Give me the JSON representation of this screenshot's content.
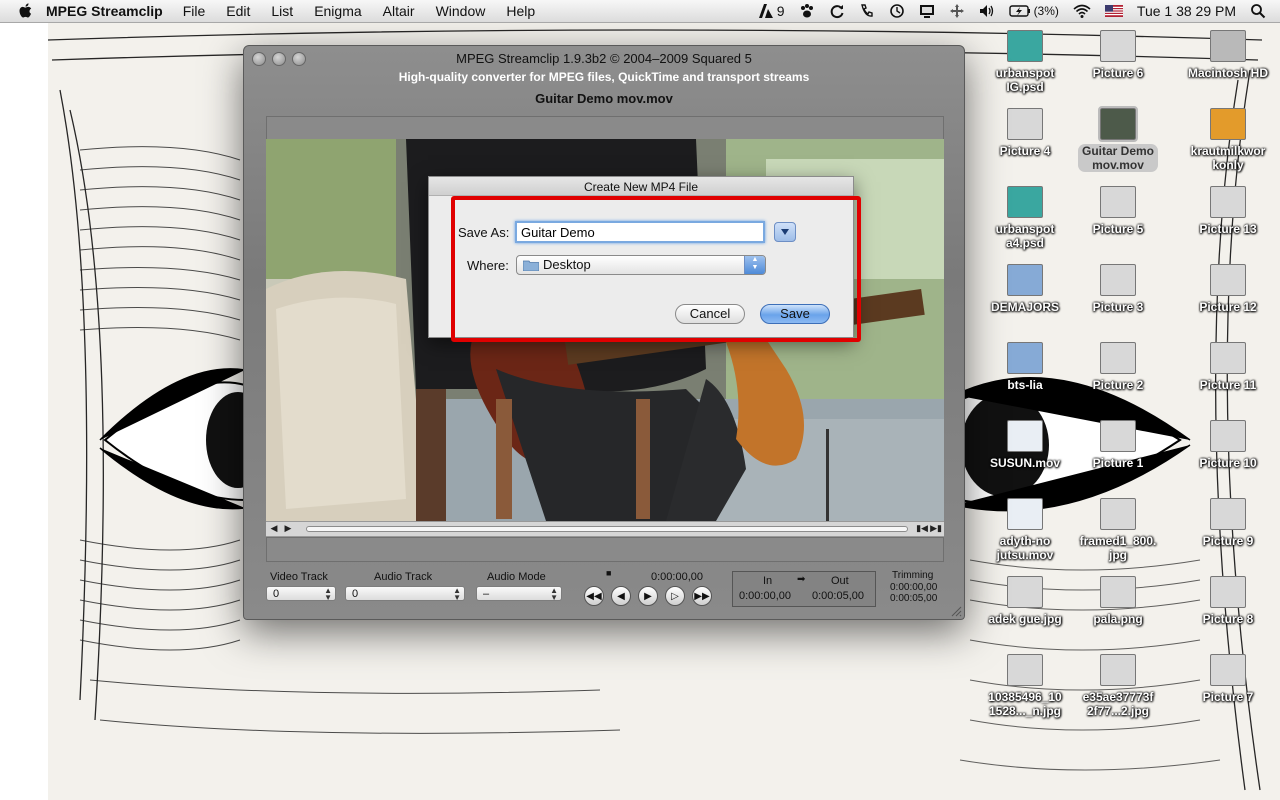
{
  "menubar": {
    "app_name": "MPEG Streamclip",
    "menus": [
      "File",
      "Edit",
      "List",
      "Enigma",
      "Altair",
      "Window",
      "Help"
    ],
    "status": {
      "adobe_count": "9",
      "battery": "(3%)",
      "clock": "Tue 1 38 29 PM"
    }
  },
  "window": {
    "title": "MPEG Streamclip 1.9.3b2  ©  2004–2009 Squared 5",
    "subtitle": "High-quality converter for MPEG files, QuickTime and transport streams",
    "file_name": "Guitar Demo mov.mov",
    "controls": {
      "video_track_label": "Video Track",
      "video_track_value": "0",
      "audio_track_label": "Audio Track",
      "audio_track_value": "0",
      "audio_mode_label": "Audio Mode",
      "audio_mode_value": "–",
      "timecode": "0:00:00,00",
      "in_label": "In",
      "out_label": "Out",
      "in_value": "0:00:00,00",
      "out_value": "0:00:05,00",
      "trimming_label": "Trimming",
      "trimming_in": "0:00:00,00",
      "trimming_out": "0:00:05,00"
    }
  },
  "dialog": {
    "title": "Create New MP4 File",
    "save_as_label": "Save As:",
    "save_as_value": "Guitar Demo",
    "where_label": "Where:",
    "where_value": "Desktop",
    "cancel_label": "Cancel",
    "save_label": "Save"
  },
  "desktop_icons": [
    {
      "label": "urbanspot\nIG.psd",
      "kind": "psd-icon"
    },
    {
      "label": "Picture 6",
      "kind": "image-icon"
    },
    {
      "label": "Macintosh HD",
      "kind": "hard-drive-icon"
    },
    {
      "label": "Picture 4",
      "kind": "image-icon"
    },
    {
      "label": "Guitar Demo\nmov.mov",
      "kind": "movie-icon"
    },
    {
      "label": "krautmilkwor\nkonly",
      "kind": "usb-drive-icon"
    },
    {
      "label": "urbanspot\na4.psd",
      "kind": "psd-icon"
    },
    {
      "label": "Picture 5",
      "kind": "image-icon"
    },
    {
      "label": "Picture 13",
      "kind": "image-icon"
    },
    {
      "label": "DEMAJORS",
      "kind": "folder-icon"
    },
    {
      "label": "Picture 3",
      "kind": "image-icon"
    },
    {
      "label": "Picture 12",
      "kind": "image-icon"
    },
    {
      "label": "bts-lia",
      "kind": "folder-icon"
    },
    {
      "label": "Picture 2",
      "kind": "image-icon"
    },
    {
      "label": "Picture 11",
      "kind": "image-icon"
    },
    {
      "label": "SUSUN.mov",
      "kind": "quicktime-icon"
    },
    {
      "label": "Picture 1",
      "kind": "image-icon"
    },
    {
      "label": "Picture 10",
      "kind": "image-icon"
    },
    {
      "label": "adyth-no\njutsu.mov",
      "kind": "quicktime-icon"
    },
    {
      "label": "framed1_800.\njpg",
      "kind": "image-icon"
    },
    {
      "label": "Picture 9",
      "kind": "image-icon"
    },
    {
      "label": "adek gue.jpg",
      "kind": "image-icon"
    },
    {
      "label": "pala.png",
      "kind": "image-icon"
    },
    {
      "label": "Picture 8",
      "kind": "image-icon"
    },
    {
      "label": "10385496_10\n1528..._n.jpg",
      "kind": "image-icon"
    },
    {
      "label": "e35ae37773f\n2f77...2.jpg",
      "kind": "image-icon"
    },
    {
      "label": "Picture 7",
      "kind": "image-icon"
    }
  ]
}
